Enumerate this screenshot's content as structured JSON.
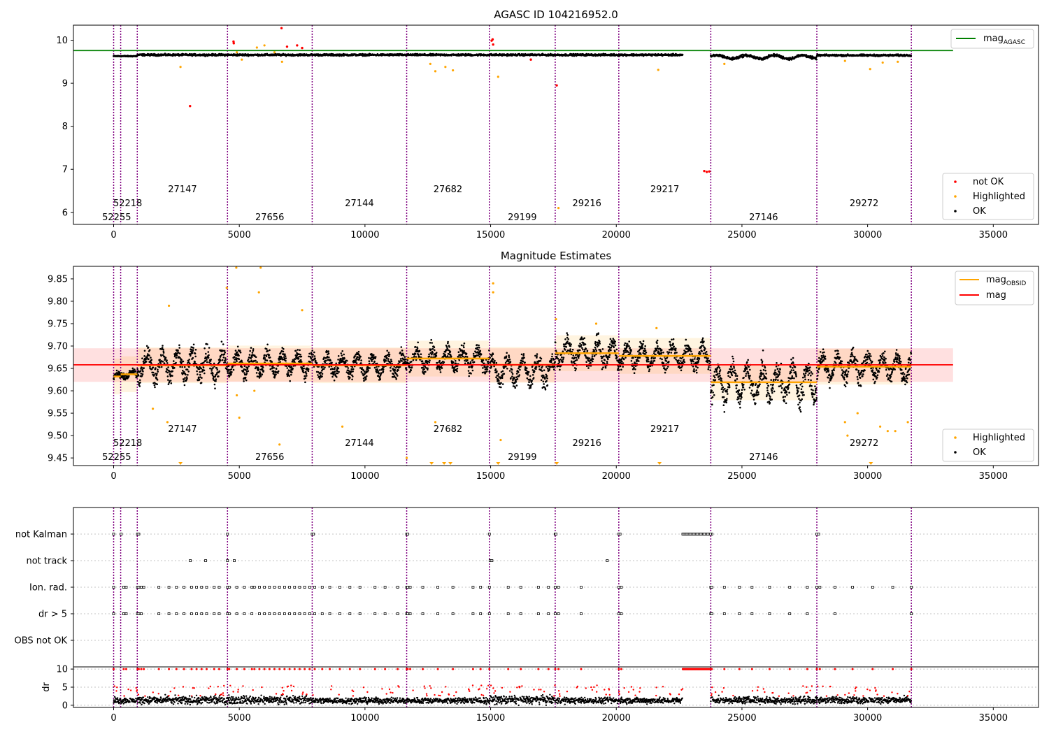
{
  "chart_data": [
    {
      "type": "scatter",
      "title": "AGASC ID 104216952.0",
      "xlim": [
        -1600,
        36800
      ],
      "ylim": [
        5.72,
        10.35
      ],
      "xticks": [
        0,
        5000,
        10000,
        15000,
        20000,
        25000,
        30000,
        35000
      ],
      "yticks": [
        6,
        7,
        8,
        9,
        10
      ],
      "obsid_boundaries": [
        0,
        280,
        940,
        4530,
        7900,
        11660,
        14950,
        17570,
        20100,
        23760,
        27980,
        31740
      ],
      "obsid_labels": [
        {
          "text": "52255",
          "x": 120,
          "y": 5.88
        },
        {
          "text": "52218",
          "x": 560,
          "y": 6.21
        },
        {
          "text": "27147",
          "x": 2740,
          "y": 6.53
        },
        {
          "text": "27656",
          "x": 6210,
          "y": 5.88
        },
        {
          "text": "27144",
          "x": 9780,
          "y": 6.21
        },
        {
          "text": "27682",
          "x": 13300,
          "y": 6.53
        },
        {
          "text": "29199",
          "x": 16260,
          "y": 5.88
        },
        {
          "text": "29216",
          "x": 18830,
          "y": 6.21
        },
        {
          "text": "29217",
          "x": 21930,
          "y": 6.53
        },
        {
          "text": "27146",
          "x": 25860,
          "y": 5.88
        },
        {
          "text": "29272",
          "x": 29860,
          "y": 6.21
        }
      ],
      "lines": [
        {
          "name": "mag_AGASC",
          "y": 9.76,
          "x": [
            -1600,
            33400
          ],
          "color": "#008000"
        }
      ],
      "series": [
        {
          "name": "not OK",
          "color": "#ff0000",
          "points": [
            [
              3040,
              8.47
            ],
            [
              17630,
              8.95
            ],
            [
              6680,
              10.28
            ],
            [
              4770,
              9.97
            ],
            [
              4780,
              9.93
            ],
            [
              6900,
              9.85
            ],
            [
              7300,
              9.88
            ],
            [
              7500,
              9.82
            ],
            [
              15040,
              9.99
            ],
            [
              15080,
              10.02
            ],
            [
              15100,
              9.9
            ],
            [
              16600,
              9.55
            ],
            [
              23500,
              6.96
            ],
            [
              23600,
              6.94
            ],
            [
              23700,
              6.95
            ]
          ]
        },
        {
          "name": "Highlighted",
          "color": "#ffa500",
          "points": [
            [
              2660,
              9.38
            ],
            [
              4900,
              9.72
            ],
            [
              5100,
              9.55
            ],
            [
              5700,
              9.83
            ],
            [
              6000,
              9.88
            ],
            [
              6400,
              9.72
            ],
            [
              6700,
              9.5
            ],
            [
              12600,
              9.45
            ],
            [
              12800,
              9.28
            ],
            [
              13200,
              9.38
            ],
            [
              13500,
              9.3
            ],
            [
              15300,
              9.15
            ],
            [
              17700,
              6.1
            ],
            [
              21670,
              9.31
            ],
            [
              24300,
              9.45
            ],
            [
              29100,
              9.52
            ],
            [
              30100,
              9.33
            ],
            [
              30600,
              9.48
            ],
            [
              31200,
              9.5
            ]
          ]
        },
        {
          "name": "OK",
          "color": "#000000",
          "segments": [
            [
              0,
              940,
              9.63,
              0.03
            ],
            [
              940,
              22650,
              9.66,
              0.06
            ],
            [
              23760,
              27980,
              9.61,
              0.09
            ],
            [
              27980,
              31740,
              9.65,
              0.06
            ]
          ]
        }
      ],
      "legend_upper": [
        "mag_AGASC"
      ],
      "legend_lower": [
        "not OK",
        "Highlighted",
        "OK"
      ],
      "legend_placement": [
        "upper right",
        "lower right"
      ]
    },
    {
      "type": "scatter",
      "title": "Magnitude Estimates",
      "xlim": [
        -1600,
        36800
      ],
      "ylim": [
        9.433,
        9.878
      ],
      "xticks": [
        0,
        5000,
        10000,
        15000,
        20000,
        25000,
        30000,
        35000
      ],
      "yticks": [
        9.45,
        9.5,
        9.55,
        9.6,
        9.65,
        9.7,
        9.75,
        9.8,
        9.85
      ],
      "obsid_boundaries": [
        0,
        280,
        940,
        4530,
        7900,
        11660,
        14950,
        17570,
        20100,
        23760,
        27980,
        31740
      ],
      "obsid_labels": [
        {
          "text": "52255",
          "x": 120,
          "y": 9.452
        },
        {
          "text": "52218",
          "x": 560,
          "y": 9.483
        },
        {
          "text": "27147",
          "x": 2740,
          "y": 9.514
        },
        {
          "text": "27656",
          "x": 6210,
          "y": 9.452
        },
        {
          "text": "27144",
          "x": 9780,
          "y": 9.483
        },
        {
          "text": "27682",
          "x": 13300,
          "y": 9.514
        },
        {
          "text": "29199",
          "x": 16260,
          "y": 9.452
        },
        {
          "text": "29216",
          "x": 18830,
          "y": 9.483
        },
        {
          "text": "29217",
          "x": 21930,
          "y": 9.514
        },
        {
          "text": "27146",
          "x": 25860,
          "y": 9.452
        },
        {
          "text": "29272",
          "x": 29860,
          "y": 9.483
        }
      ],
      "mag": {
        "value": 9.658,
        "band": [
          9.62,
          9.695
        ],
        "x": [
          -1600,
          33400
        ],
        "color": "#ff0000"
      },
      "mag_obsid": [
        [
          0,
          280,
          9.632
        ],
        [
          280,
          940,
          9.637
        ],
        [
          940,
          4530,
          9.657
        ],
        [
          4530,
          7900,
          9.661
        ],
        [
          7900,
          11660,
          9.657
        ],
        [
          11660,
          14950,
          9.672
        ],
        [
          14950,
          17570,
          9.658
        ],
        [
          17570,
          20100,
          9.684
        ],
        [
          20100,
          23760,
          9.678
        ],
        [
          23760,
          27980,
          9.619
        ],
        [
          27980,
          31740,
          9.654
        ]
      ],
      "segments": [
        [
          0,
          280,
          9.632,
          0.015
        ],
        [
          280,
          940,
          9.637,
          0.018
        ],
        [
          940,
          4530,
          9.657,
          0.06
        ],
        [
          4530,
          7900,
          9.661,
          0.045
        ],
        [
          7900,
          11660,
          9.657,
          0.045
        ],
        [
          11660,
          14950,
          9.672,
          0.045
        ],
        [
          14950,
          17570,
          9.645,
          0.05
        ],
        [
          17570,
          20100,
          9.684,
          0.05
        ],
        [
          20100,
          23760,
          9.678,
          0.045
        ],
        [
          23760,
          27980,
          9.619,
          0.07
        ],
        [
          27980,
          31740,
          9.654,
          0.05
        ]
      ],
      "highlighted_points": [
        [
          4880,
          9.875
        ],
        [
          5850,
          9.875
        ],
        [
          2200,
          9.79
        ],
        [
          4500,
          9.83
        ],
        [
          5780,
          9.82
        ],
        [
          1560,
          9.56
        ],
        [
          2140,
          9.53
        ],
        [
          4900,
          9.59
        ],
        [
          5000,
          9.54
        ],
        [
          5600,
          9.6
        ],
        [
          6600,
          9.48
        ],
        [
          7500,
          9.78
        ],
        [
          9100,
          9.52
        ],
        [
          11660,
          9.45
        ],
        [
          12800,
          9.53
        ],
        [
          15400,
          9.49
        ],
        [
          15100,
          9.84
        ],
        [
          15100,
          9.82
        ],
        [
          17600,
          9.76
        ],
        [
          19200,
          9.75
        ],
        [
          21600,
          9.74
        ],
        [
          29100,
          9.53
        ],
        [
          29200,
          9.5
        ],
        [
          29600,
          9.55
        ],
        [
          30500,
          9.52
        ],
        [
          30800,
          9.51
        ],
        [
          31100,
          9.51
        ],
        [
          31600,
          9.53
        ]
      ],
      "highlighted_bottom": [
        2660,
        12650,
        13150,
        13400,
        15300,
        17630,
        21720,
        30130
      ],
      "legend_upper": [
        "mag_OBSID",
        "mag"
      ],
      "legend_lower": [
        "Highlighted",
        "OK"
      ],
      "legend_placement": [
        "upper right",
        "lower right"
      ]
    },
    {
      "type": "scatter",
      "xlim": [
        -1600,
        36800
      ],
      "xticks": [
        0,
        5000,
        10000,
        15000,
        20000,
        25000,
        30000,
        35000
      ],
      "obsid_boundaries": [
        0,
        280,
        940,
        4530,
        7900,
        11660,
        14950,
        17570,
        20100,
        23760,
        27980,
        31740
      ],
      "flag_labels": [
        "not Kalman",
        "not track",
        "Ion. rad.",
        "dr > 5",
        "OBS not OK"
      ],
      "flags": [
        {
          "name": "not Kalman",
          "x": [
            0,
            300,
            950,
            1000,
            4530,
            7900,
            7950,
            11660,
            11700,
            14950,
            17570,
            17600,
            20100,
            20150,
            23760,
            23800,
            27980,
            28050
          ]
        },
        {
          "name": "not track",
          "x": [
            3050,
            3660,
            4530,
            4800,
            14980,
            15050,
            19640
          ]
        },
        {
          "name": "Ion. rad.",
          "x": [
            0,
            400,
            500,
            950,
            1000,
            1100,
            1200,
            1800,
            2200,
            2500,
            2800,
            3100,
            3300,
            3500,
            3700,
            4000,
            4200,
            4530,
            4600,
            4900,
            5200,
            5500,
            5600,
            5800,
            6000,
            6200,
            6400,
            6600,
            6800,
            7000,
            7200,
            7400,
            7600,
            7800,
            8000,
            8300,
            8600,
            9000,
            9400,
            9800,
            10400,
            10800,
            11300,
            11660,
            11700,
            11800,
            12300,
            12900,
            13500,
            14300,
            14600,
            14950,
            15700,
            16200,
            16900,
            17300,
            17570,
            17700,
            18600,
            20100,
            20200,
            23760,
            23800,
            24300,
            24900,
            25400,
            26100,
            26900,
            27600,
            27980,
            28100,
            28700,
            29400,
            30200,
            31000,
            31740
          ]
        },
        {
          "name": "dr > 5",
          "x": [
            0,
            400,
            500,
            950,
            1000,
            1100,
            1800,
            2200,
            2500,
            2800,
            3100,
            3300,
            3500,
            3700,
            4000,
            4200,
            4530,
            4600,
            4900,
            5200,
            5500,
            5800,
            6000,
            6200,
            6400,
            6600,
            6800,
            7000,
            7200,
            7400,
            7600,
            7800,
            8000,
            8300,
            8600,
            9000,
            9400,
            9800,
            10400,
            10800,
            11300,
            11660,
            11700,
            11800,
            12300,
            12900,
            13500,
            14300,
            14600,
            14950,
            15700,
            16200,
            16900,
            17300,
            17570,
            17700,
            18600,
            20100,
            20200,
            23760,
            23800,
            24300,
            24900,
            25400,
            26100,
            26900,
            27600,
            28700,
            31740
          ]
        },
        {
          "name": "OBS not OK",
          "x": []
        }
      ],
      "not_kalman_run": [
        22650,
        23760
      ],
      "dr_panel": {
        "ylabel": "dr",
        "yticks": [
          0,
          5,
          10
        ],
        "ylim": [
          -0.6,
          10.6
        ],
        "segments": [
          [
            0,
            940,
            1.3,
            1.5
          ],
          [
            940,
            4530,
            1.4,
            2.0
          ],
          [
            4530,
            7900,
            1.5,
            2.0
          ],
          [
            7900,
            11660,
            1.3,
            1.5
          ],
          [
            11660,
            14950,
            1.3,
            1.5
          ],
          [
            14950,
            17570,
            1.5,
            2.0
          ],
          [
            17570,
            20100,
            1.3,
            1.5
          ],
          [
            20100,
            22650,
            1.3,
            1.5
          ],
          [
            23760,
            27980,
            1.4,
            1.7
          ],
          [
            27980,
            31740,
            1.4,
            1.7
          ]
        ],
        "ten_run": [
          22650,
          23760
        ],
        "color_ok": "#000000",
        "color_high": "#ff0000"
      }
    }
  ]
}
